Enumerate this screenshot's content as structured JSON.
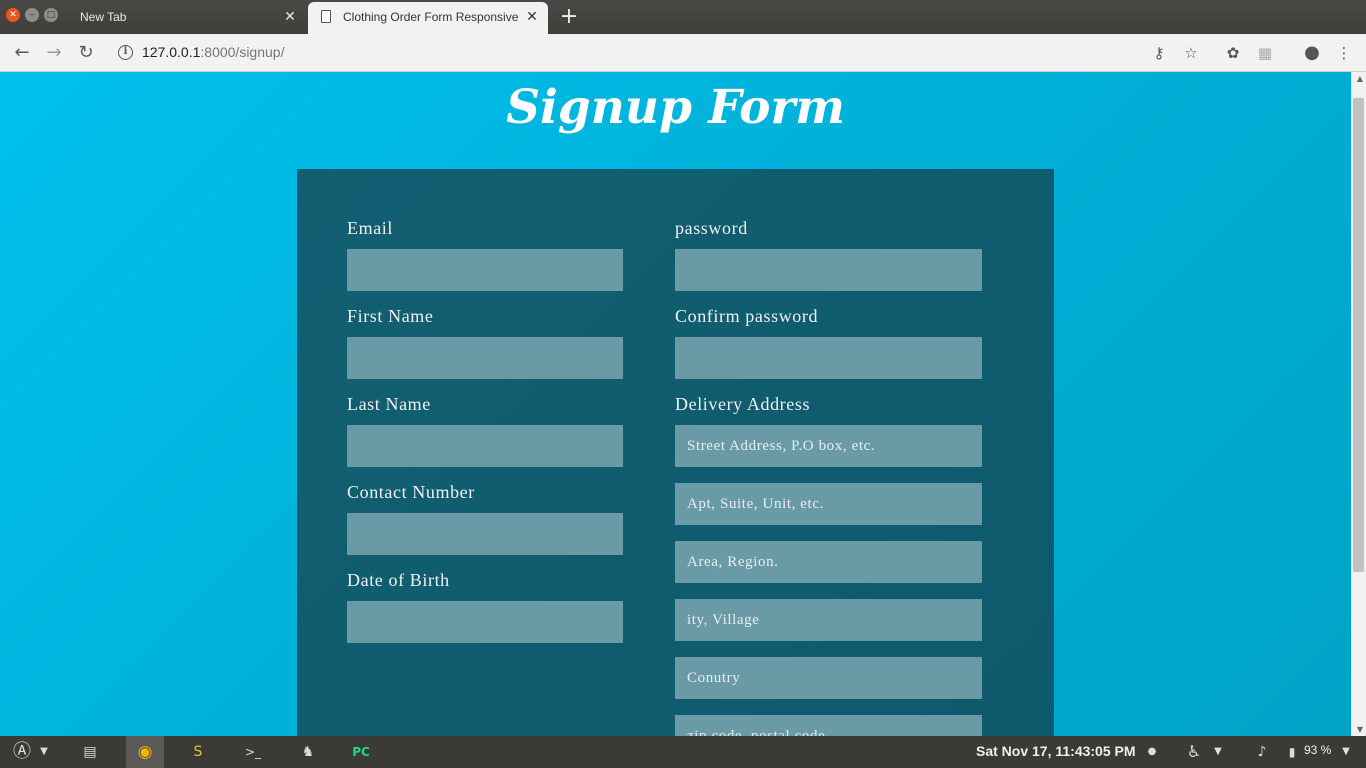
{
  "browser": {
    "tabs": [
      {
        "title": "New Tab",
        "active": false
      },
      {
        "title": "Clothing Order Form Responsive",
        "active": true
      }
    ],
    "new_tab_icon": "plus-icon",
    "url_host": "127.0.0.1",
    "url_rest": ":8000/signup/"
  },
  "page": {
    "title": "Signup Form",
    "left_fields": [
      {
        "label": "Email",
        "value": "",
        "placeholder": ""
      },
      {
        "label": "First Name",
        "value": "",
        "placeholder": ""
      },
      {
        "label": "Last Name",
        "value": "",
        "placeholder": ""
      },
      {
        "label": "Contact Number",
        "value": "",
        "placeholder": ""
      },
      {
        "label": "Date of Birth",
        "value": "",
        "placeholder": ""
      }
    ],
    "right_fields": [
      {
        "label": "password",
        "value": "",
        "placeholder": ""
      },
      {
        "label": "Confirm password",
        "value": "",
        "placeholder": ""
      }
    ],
    "delivery": {
      "label": "Delivery Address",
      "placeholders": [
        "Street Address, P.O box, etc.",
        "Apt, Suite, Unit, etc.",
        "Area, Region.",
        "ity, Village",
        "Conutry",
        "zip code, postal code"
      ]
    }
  },
  "taskbar": {
    "clock": "Sat Nov 17, 11:43:05 PM",
    "battery": "93 %"
  },
  "colors": {
    "page_bg": "#00b4dc",
    "panel_bg": "#125f72",
    "input_bg": "#6a9aa5"
  }
}
